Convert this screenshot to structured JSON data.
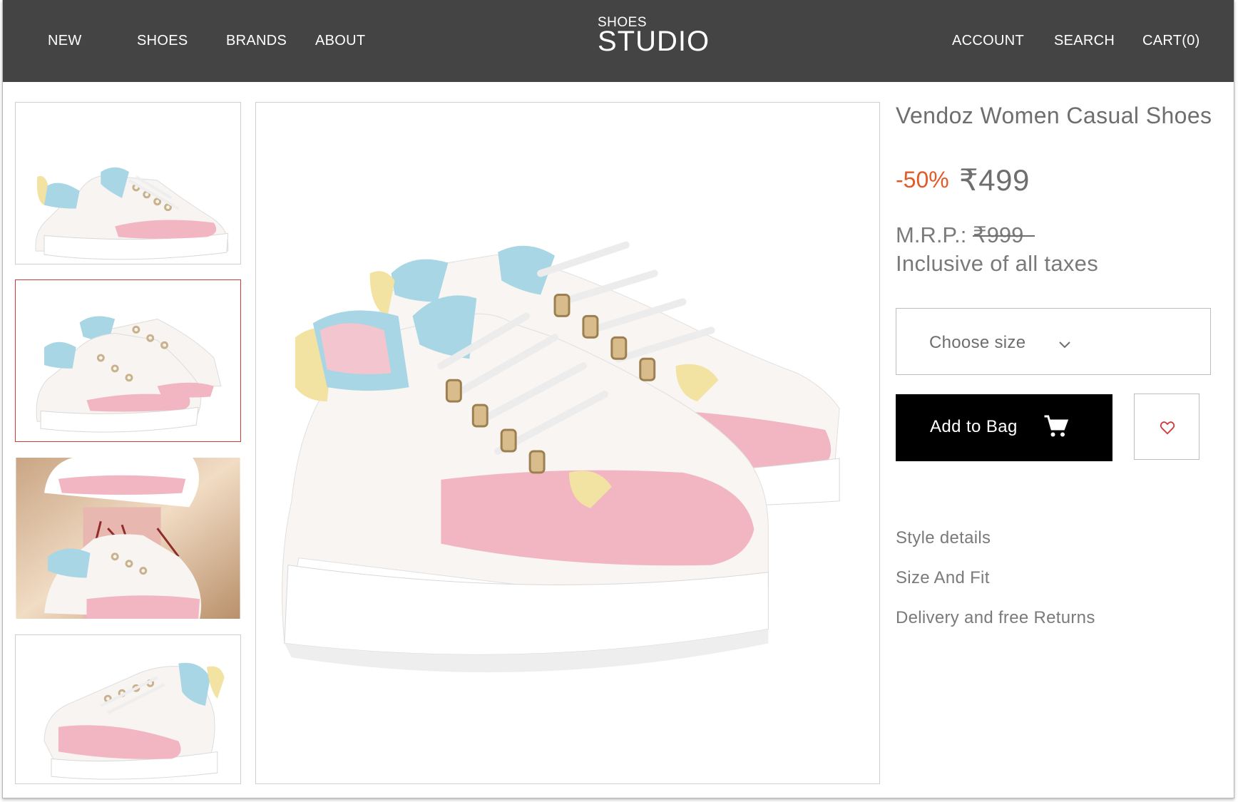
{
  "colors": {
    "header_bg": "#444444",
    "discount": "#e35a29",
    "selected_thumb_border": "#d23a3a",
    "add_to_bag_bg": "#000000",
    "shoe_pink": "#f2b6c2",
    "shoe_blue": "#a9d6e5",
    "shoe_yellow": "#f3e3a2"
  },
  "header": {
    "nav_left": [
      "NEW",
      "SHOES",
      "BRANDS",
      "ABOUT"
    ],
    "logo_small": "SHOES",
    "logo_big": "STUDIO",
    "nav_right": [
      "ACCOUNT",
      "SEARCH",
      "CART(0)"
    ]
  },
  "gallery": {
    "thumbnails": [
      {
        "view": "single-side-view",
        "selected": false
      },
      {
        "view": "pair-view",
        "selected": true
      },
      {
        "view": "lifestyle-view",
        "selected": false
      },
      {
        "view": "front-angle-view",
        "selected": false
      }
    ],
    "main_image": "pair-view"
  },
  "product": {
    "title": "Vendoz Women Casual Shoes",
    "discount": "-50%",
    "price": "₹499",
    "mrp_label": "M.R.P.:",
    "mrp_value": "₹999",
    "tax_note": "Inclusive of all taxes",
    "size_placeholder": "Choose size",
    "add_to_bag": "Add to Bag",
    "details": [
      "Style details",
      "Size And Fit",
      "Delivery and free Returns"
    ]
  },
  "icons": {
    "size_dropdown": "chevron-down-icon",
    "add_to_bag": "cart-icon",
    "wishlist": "heart-icon"
  }
}
